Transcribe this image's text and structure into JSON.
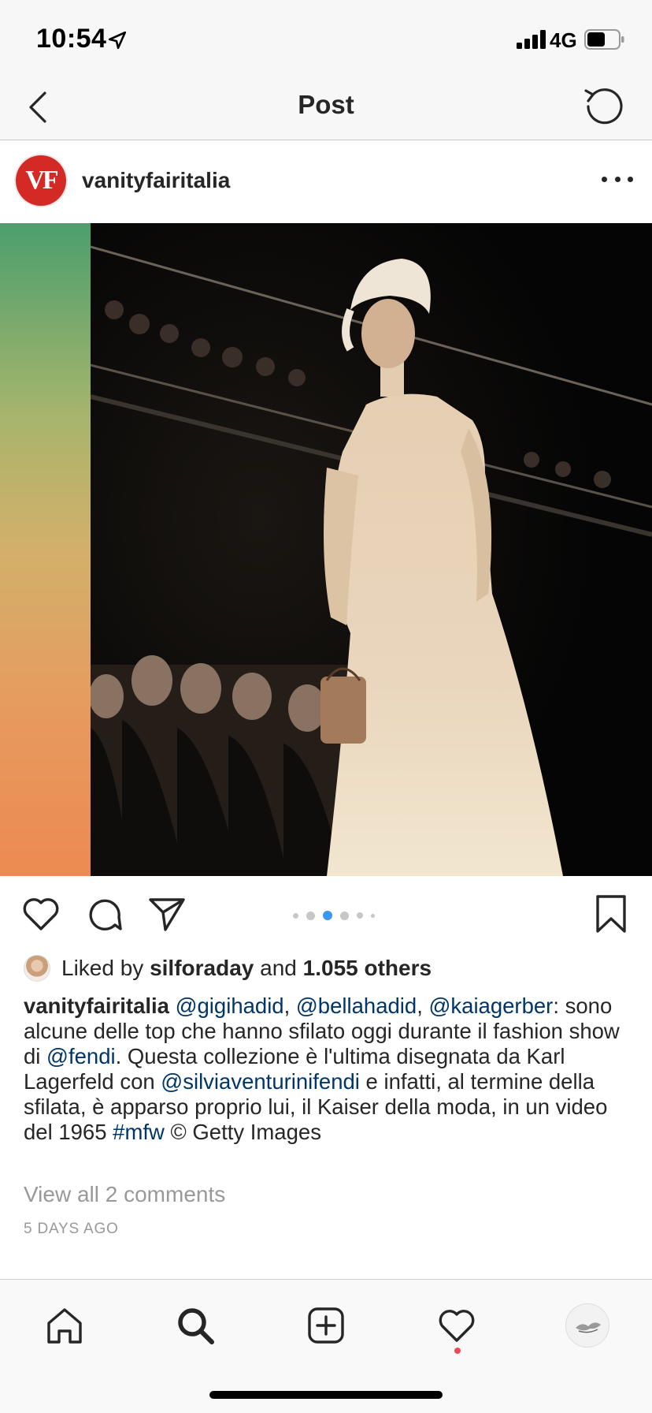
{
  "status_bar": {
    "time": "10:54",
    "network": "4G"
  },
  "nav": {
    "title": "Post"
  },
  "post": {
    "username": "vanityfairitalia",
    "avatar_text": "VF",
    "image_description_colors": {
      "gradient_top": "#4b9f6d",
      "gradient_bottom": "#ec8a52"
    },
    "carousel": {
      "count": 6,
      "active_index": 2,
      "active_color": "#3897f0"
    },
    "likes": {
      "prefix": "Liked by",
      "user": "silforaday",
      "joiner": "and",
      "others": "1.055 others"
    },
    "caption": {
      "user": "vanityfairitalia",
      "mention_1": "@gigihadid",
      "sep_1": ", ",
      "mention_2": "@bellahadid",
      "sep_2": ", ",
      "mention_3": "@kaiagerber",
      "text_1": ": sono alcune delle top che hanno sfilato oggi durante il fashion show di ",
      "mention_4": "@fendi",
      "text_2": ". Questa collezione è l'ultima disegnata da Karl Lagerfeld con ",
      "mention_5": "@silviaventurinifendi",
      "text_3": " e infatti, al termine della sfilata, è apparso proprio lui, il Kaiser della moda, in un video del 1965 ",
      "hashtag": "#mfw",
      "text_4": " © Getty Images"
    },
    "view_comments": "View all 2 comments",
    "timestamp": "5 DAYS AGO"
  },
  "tab_bar": {
    "items": [
      "home-icon",
      "search-icon",
      "add-icon",
      "heart-icon",
      "profile"
    ]
  }
}
